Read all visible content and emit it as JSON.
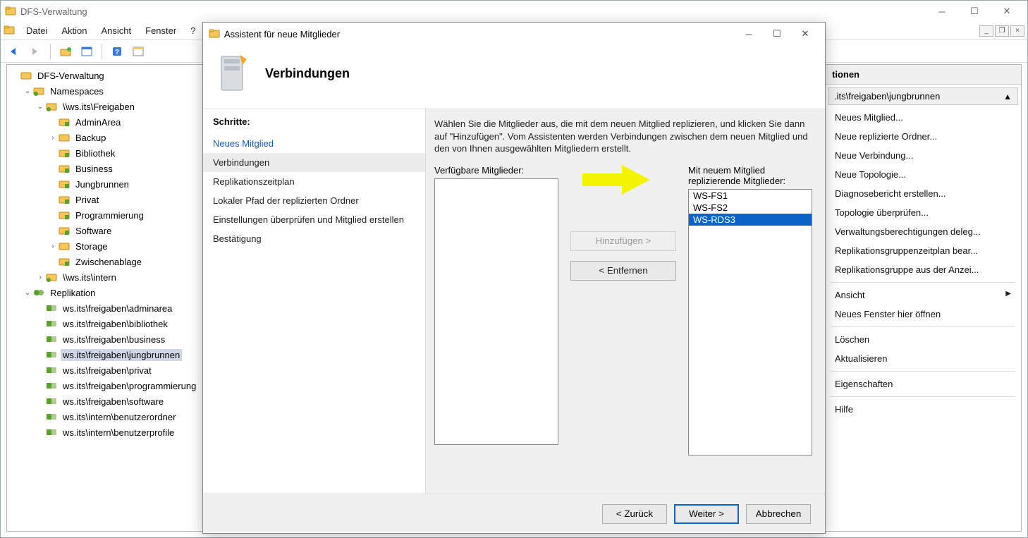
{
  "main_window": {
    "title": "DFS-Verwaltung",
    "menu": {
      "file": "Datei",
      "action": "Aktion",
      "view": "Ansicht",
      "window": "Fenster",
      "help": "?"
    }
  },
  "tree": {
    "root": "DFS-Verwaltung",
    "namespaces": "Namespaces",
    "ns_freigaben": "\\\\ws.its\\Freigaben",
    "ns_children": {
      "adminarea": "AdminArea",
      "backup": "Backup",
      "bibliothek": "Bibliothek",
      "business": "Business",
      "jungbrunnen": "Jungbrunnen",
      "privat": "Privat",
      "programmierung": "Programmierung",
      "software": "Software",
      "storage": "Storage",
      "zwischenablage": "Zwischenablage"
    },
    "ns_intern": "\\\\ws.its\\intern",
    "replication": "Replikation",
    "repl_items": {
      "r0": "ws.its\\freigaben\\adminarea",
      "r1": "ws.its\\freigaben\\bibliothek",
      "r2": "ws.its\\freigaben\\business",
      "r3": "ws.its\\freigaben\\jungbrunnen",
      "r4": "ws.its\\freigaben\\privat",
      "r5": "ws.its\\freigaben\\programmierung",
      "r6": "ws.its\\freigaben\\software",
      "r7": "ws.its\\intern\\benutzerordner",
      "r8": "ws.its\\intern\\benutzerprofile"
    }
  },
  "actions": {
    "header": "tionen",
    "group_title": ".its\\freigaben\\jungbrunnen",
    "items": {
      "a0": "Neues Mitglied...",
      "a1": "Neue replizierte Ordner...",
      "a2": "Neue Verbindung...",
      "a3": "Neue Topologie...",
      "a4": "Diagnosebericht erstellen...",
      "a5": "Topologie überprüfen...",
      "a6": "Verwaltungsberechtigungen deleg...",
      "a7": "Replikationsgruppenzeitplan bear...",
      "a8": "Replikationsgruppe aus der Anzei...",
      "a9": "Ansicht",
      "a10": "Neues Fenster hier öffnen",
      "a11": "Löschen",
      "a12": "Aktualisieren",
      "a13": "Eigenschaften",
      "a14": "Hilfe"
    }
  },
  "wizard": {
    "title": "Assistent für neue Mitglieder",
    "page_title": "Verbindungen",
    "steps_header": "Schritte:",
    "steps": {
      "s0": "Neues Mitglied",
      "s1": "Verbindungen",
      "s2": "Replikationszeitplan",
      "s3": "Lokaler Pfad der replizierten Ordner",
      "s4": "Einstellungen überprüfen und Mitglied erstellen",
      "s5": "Bestätigung"
    },
    "instruction": "Wählen Sie die Mitglieder aus, die mit dem neuen Mitglied replizieren, und klicken Sie dann auf \"Hinzufügen\". Vom Assistenten werden Verbindungen zwischen dem neuen Mitglied und den von Ihnen ausgewählten Mitgliedern erstellt.",
    "left_label": "Verfügbare Mitglieder:",
    "right_label": "Mit neuem Mitglied replizierende Mitglieder:",
    "add_btn": "Hinzufügen >",
    "remove_btn": "< Entfernen",
    "members": {
      "m0": "WS-FS1",
      "m1": "WS-FS2",
      "m2": "WS-RDS3"
    },
    "footer": {
      "back": "< Zurück",
      "next": "Weiter >",
      "cancel": "Abbrechen"
    }
  }
}
